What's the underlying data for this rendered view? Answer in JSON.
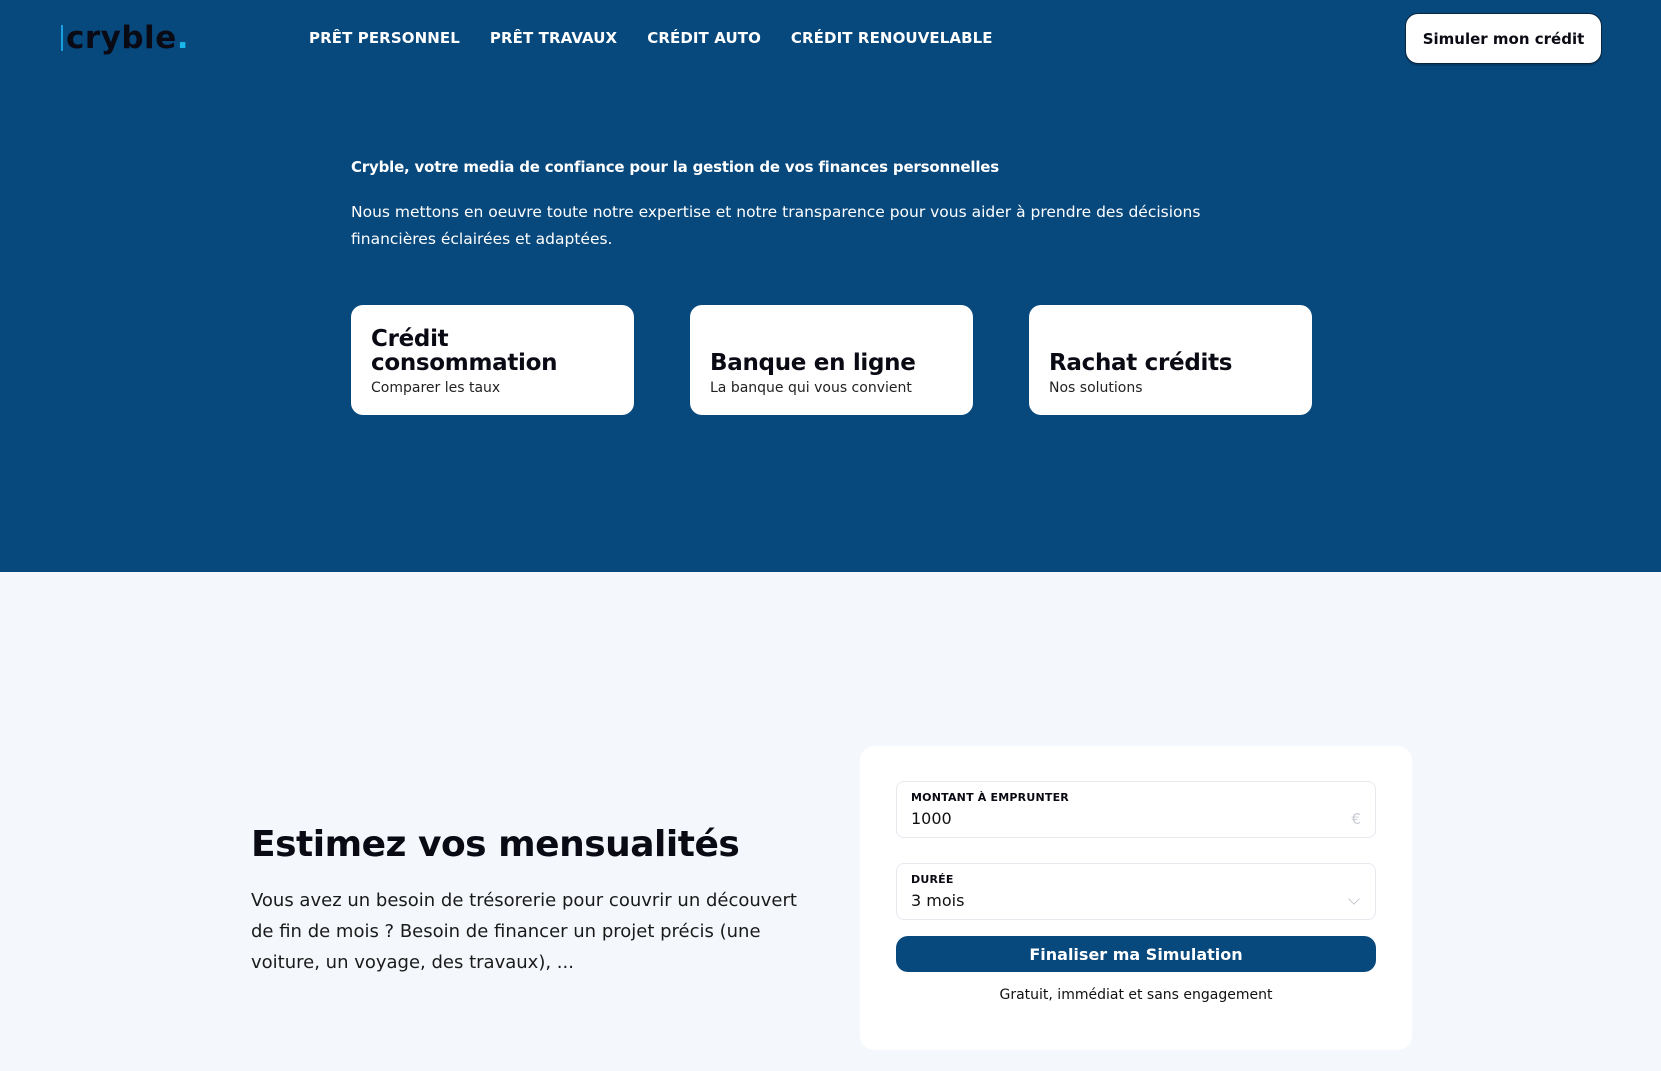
{
  "header": {
    "logo_text": "cryble",
    "logo_dot": ".",
    "nav": [
      "PRÊT PERSONNEL",
      "PRÊT TRAVAUX",
      "CRÉDIT AUTO",
      "CRÉDIT RENOUVELABLE"
    ],
    "cta_label": "Simuler mon crédit"
  },
  "hero": {
    "title": "Cryble, votre media de confiance pour la gestion de vos finances personnelles",
    "text": "Nous mettons en oeuvre toute notre expertise et notre transparence pour vous aider à prendre des décisions financières éclairées et adaptées.",
    "cards": [
      {
        "title": "Crédit consommation",
        "subtitle": "Comparer les taux"
      },
      {
        "title": "Banque en ligne",
        "subtitle": "La banque qui vous convient"
      },
      {
        "title": "Rachat crédits",
        "subtitle": "Nos solutions"
      }
    ]
  },
  "estimate": {
    "title": "Estimez vos mensualités",
    "text": "Vous avez un besoin de trésorerie pour couvrir un découvert de fin de mois ? Besoin de financer un projet précis (une voiture, un voyage, des travaux), ..."
  },
  "simulator": {
    "amount_label": "MONTANT À EMPRUNTER",
    "amount_value": "1000",
    "amount_suffix": "€",
    "duration_label": "DURÉE",
    "duration_value": "3 mois",
    "submit_label": "Finaliser ma Simulation",
    "note": "Gratuit, immédiat et sans engagement"
  },
  "colors": {
    "brand_blue": "#07487d",
    "accent_cyan": "#1ab6ea",
    "page_background": "#f4f7fb"
  }
}
